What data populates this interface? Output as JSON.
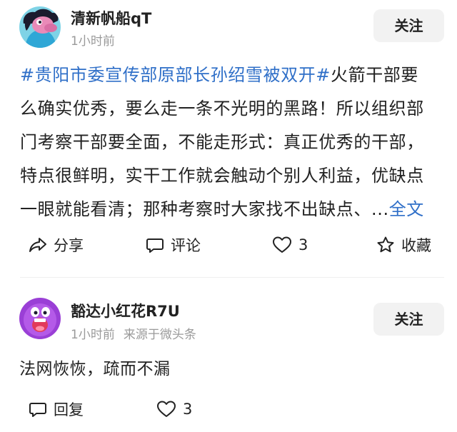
{
  "post": {
    "author": "清新帆船qT",
    "time": "1小时前",
    "follow_label": "关注",
    "hashtag": "#贵阳市委宣传部原部长孙绍雪被双开#",
    "lines": [
      "火箭干部要",
      "么确实优秀，要么走一条不光明的黑路！所以组织部",
      "门考察干部要全面，不能走形式：真正优秀的干部，",
      "特点很鲜明，实干工作就会触动个别人利益，优缺点",
      "一眼就能看清；那种考察时大家找不出缺点、..."
    ],
    "full_text_link": "全文",
    "actions": {
      "share": "分享",
      "comment": "评论",
      "likes": "3",
      "favorite": "收藏"
    }
  },
  "comment": {
    "author": "豁达小红花R7U",
    "time": "1小时前",
    "source": "来源于微头条",
    "follow_label": "关注",
    "text": "法网恢恢，疏而不漏",
    "reply_label": "回复",
    "likes": "3"
  },
  "colors": {
    "link_blue": "#2f6fc8",
    "meta_gray": "#9a9a9a",
    "button_bg": "#f2f2f2"
  },
  "icons": {
    "share": "share-arrow-icon",
    "comment": "comment-bubble-icon",
    "like": "heart-icon",
    "favorite": "star-icon",
    "reply": "reply-bubble-icon"
  }
}
